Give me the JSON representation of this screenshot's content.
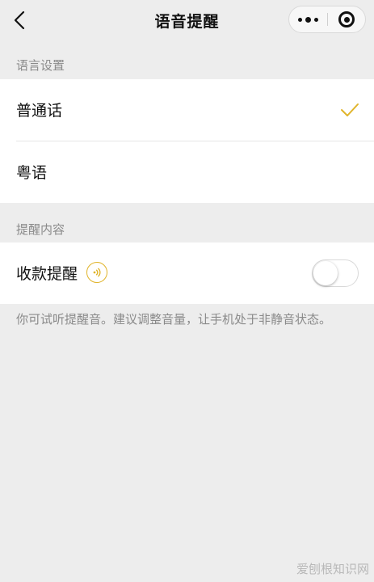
{
  "header": {
    "title": "语音提醒",
    "back_icon": "back-arrow-icon",
    "more_icon": "more-dots-icon",
    "close_icon": "miniprogram-close-icon"
  },
  "sections": [
    {
      "label": "语言设置",
      "items": [
        {
          "label": "普通话",
          "selected": true,
          "check_icon": "checkmark-icon"
        },
        {
          "label": "粤语",
          "selected": false
        }
      ]
    },
    {
      "label": "提醒内容",
      "items": [
        {
          "label": "收款提醒",
          "icon": "sound-wave-icon",
          "toggle_on": false
        }
      ]
    }
  ],
  "hint": "你可试听提醒音。建议调整音量，让手机处于非静音状态。",
  "watermark": "爱刨根知识网",
  "colors": {
    "background": "#ededed",
    "card": "#ffffff",
    "accent_gold": "#e0b42a",
    "secondary_text": "#8a8a8a"
  }
}
